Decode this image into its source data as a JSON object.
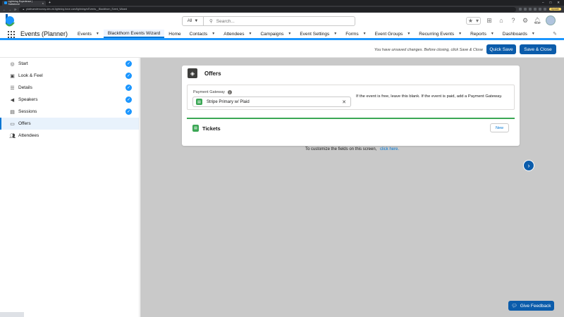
{
  "browser": {
    "tab_title": "Lightning Experience | Salesforce",
    "new_tab": "+",
    "url": "platinumdevsoncy-dev-ed.lightning.force.com/lightning/n/Events__Blackthorn_Event_Wizard",
    "update_label": "Update",
    "window_controls": [
      "–",
      "□",
      "✕"
    ]
  },
  "global_header": {
    "search_scope": "All",
    "search_placeholder": "Search..."
  },
  "app_nav": {
    "app_name": "Events (Planner)",
    "items": [
      {
        "label": "Events",
        "has_menu": true,
        "active": false
      },
      {
        "label": "Blackthorn Events Wizard",
        "has_menu": false,
        "active": true
      },
      {
        "label": "Home",
        "has_menu": false,
        "active": false
      },
      {
        "label": "Contacts",
        "has_menu": true,
        "active": false
      },
      {
        "label": "Attendees",
        "has_menu": true,
        "active": false
      },
      {
        "label": "Campaigns",
        "has_menu": true,
        "active": false
      },
      {
        "label": "Event Settings",
        "has_menu": true,
        "active": false
      },
      {
        "label": "Forms",
        "has_menu": true,
        "active": false
      },
      {
        "label": "Event Groups",
        "has_menu": true,
        "active": false
      },
      {
        "label": "Recurring Events",
        "has_menu": true,
        "active": false
      },
      {
        "label": "Reports",
        "has_menu": true,
        "active": false
      },
      {
        "label": "Dashboards",
        "has_menu": true,
        "active": false
      }
    ]
  },
  "action_bar": {
    "unsaved_message": "You have unsaved changes. Before closing, click Save & Close",
    "quick_save_label": "Quick Save",
    "save_close_label": "Save & Close"
  },
  "sidebar": {
    "steps": [
      {
        "label": "Start",
        "icon": "target-icon",
        "completed": true
      },
      {
        "label": "Look & Feel",
        "icon": "image-icon",
        "completed": true
      },
      {
        "label": "Details",
        "icon": "list-icon",
        "completed": true
      },
      {
        "label": "Speakers",
        "icon": "megaphone-icon",
        "completed": true
      },
      {
        "label": "Sessions",
        "icon": "sessions-icon",
        "completed": true
      },
      {
        "label": "Offers",
        "icon": "ticket-icon",
        "completed": false
      },
      {
        "label": "Attendees",
        "icon": "people-icon",
        "completed": false
      }
    ],
    "active_step": "Offers"
  },
  "offers_card": {
    "title": "Offers",
    "payment_gateway": {
      "label": "Payment Gateway",
      "value": "Stripe Primary w/ Plaid",
      "help_text": "If the event is free, leave this blank. If the event is paid, add a Payment Gateway."
    },
    "tickets": {
      "title": "Tickets",
      "new_label": "New"
    }
  },
  "customize": {
    "text": "To customize the fields on this screen,",
    "link": "click here."
  },
  "feedback_label": "Give Feedback",
  "colors": {
    "brand": "#0b5cab",
    "accent": "#1b96ff",
    "success": "#3ba755",
    "main_bg": "#c9c9c9"
  }
}
